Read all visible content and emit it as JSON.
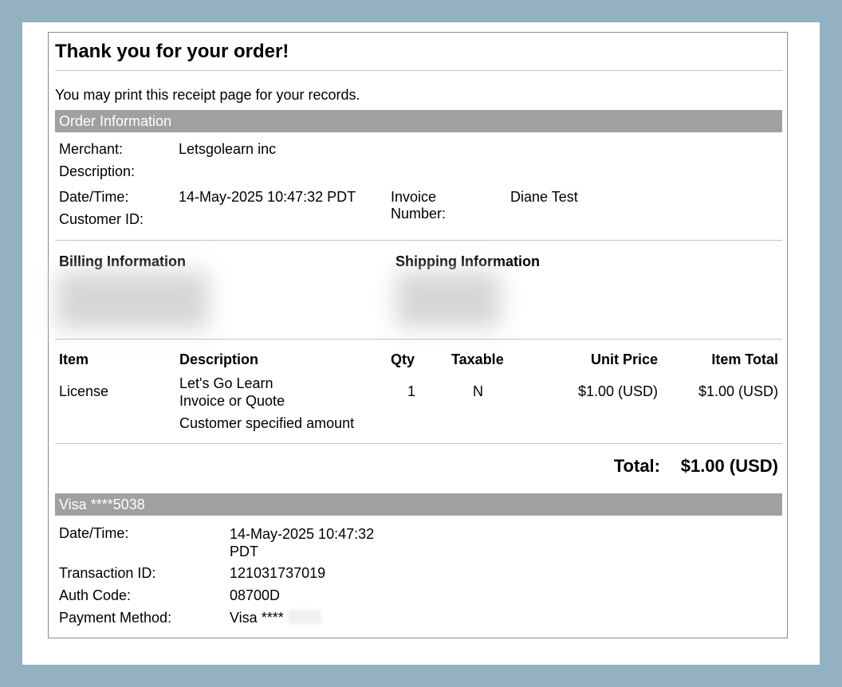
{
  "header": {
    "title": "Thank you for your order!",
    "intro": "You may print this receipt page for your records."
  },
  "order_info": {
    "section_title": "Order Information",
    "merchant_label": "Merchant:",
    "merchant_value": "Letsgolearn inc",
    "description_label": "Description:",
    "datetime_label": "Date/Time:",
    "datetime_value": "14-May-2025 10:47:32 PDT",
    "customer_id_label": "Customer ID:",
    "invoice_label_line1": "Invoice",
    "invoice_label_line2": "Number:",
    "invoice_value": "Diane Test"
  },
  "billing": {
    "billing_title": "Billing Information",
    "shipping_title": "Shipping Information"
  },
  "items": {
    "headers": {
      "item": "Item",
      "description": "Description",
      "qty": "Qty",
      "taxable": "Taxable",
      "unit_price": "Unit Price",
      "item_total": "Item Total"
    },
    "rows": [
      {
        "item": "License",
        "description_line1": "Let's Go Learn",
        "description_line2": "Invoice or Quote",
        "description_line3": "Customer specified amount",
        "qty": "1",
        "taxable": "N",
        "unit_price": "$1.00 (USD)",
        "item_total": "$1.00 (USD)"
      }
    ]
  },
  "totals": {
    "label": "Total:",
    "value": "$1.00 (USD)"
  },
  "payment": {
    "section_title": "Visa ****5038",
    "datetime_label": "Date/Time:",
    "datetime_line1": "14-May-2025 10:47:32",
    "datetime_line2": "PDT",
    "transaction_label": "Transaction ID:",
    "transaction_value": "121031737019",
    "auth_label": "Auth Code:",
    "auth_value": "08700D",
    "method_label": "Payment Method:",
    "method_value": "Visa ****"
  }
}
